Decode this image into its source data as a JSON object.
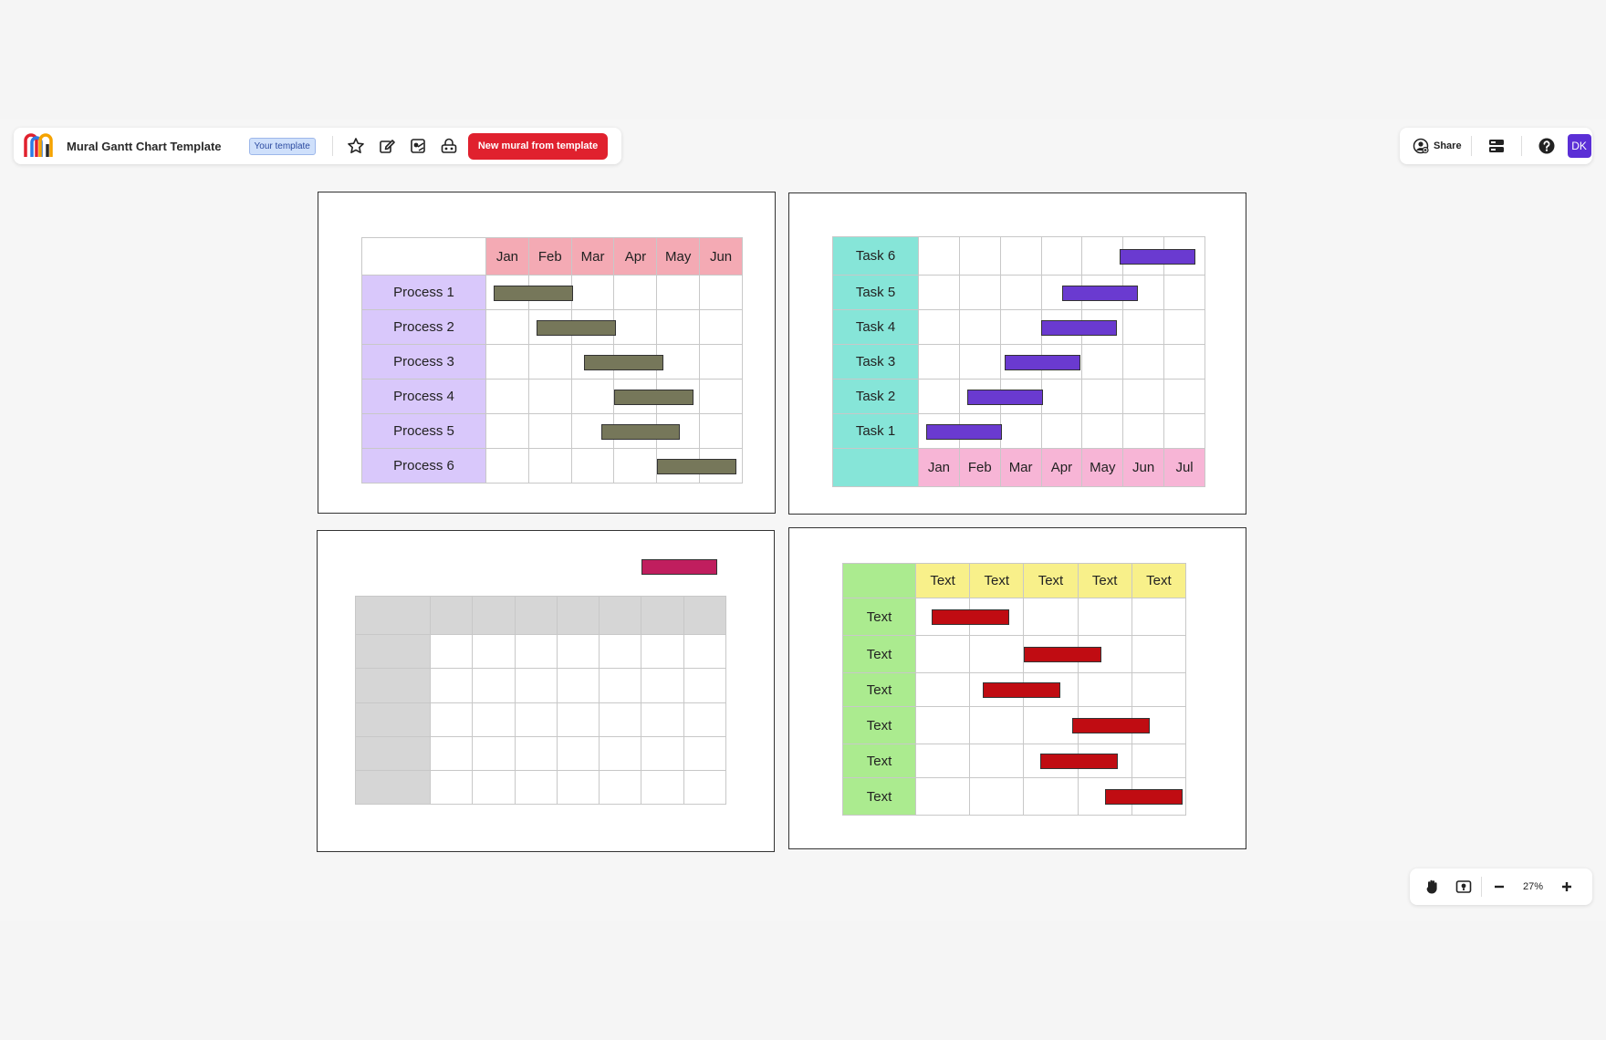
{
  "header": {
    "title": "Mural Gantt Chart Template",
    "badge": "Your template",
    "cta": "New mural from template"
  },
  "right": {
    "share": "Share",
    "avatar": "DK"
  },
  "zoom": {
    "level": "27%"
  },
  "colors": {
    "cta": "#e0212e",
    "avatar": "#5b2fd6",
    "olive_bar": "#76775a",
    "purple_bar": "#6a3ad0",
    "crimson_bar": "#c01e5e",
    "red_bar": "#c00c12"
  },
  "chart_data": [
    {
      "type": "table",
      "months": [
        "Jan",
        "Feb",
        "Mar",
        "Apr",
        "May",
        "Jun"
      ],
      "rows": [
        {
          "label": "Process 1",
          "start": 0.2,
          "end": 2.0
        },
        {
          "label": "Process 2",
          "start": 1.2,
          "end": 3.0
        },
        {
          "label": "Process 3",
          "start": 2.3,
          "end": 4.1
        },
        {
          "label": "Process 4",
          "start": 3.0,
          "end": 4.8
        },
        {
          "label": "Process 5",
          "start": 2.7,
          "end": 4.5
        },
        {
          "label": "Process 6",
          "start": 4.0,
          "end": 5.8
        }
      ]
    },
    {
      "type": "table",
      "months": [
        "Jan",
        "Feb",
        "Mar",
        "Apr",
        "May",
        "Jun",
        "Jul"
      ],
      "rows": [
        {
          "label": "Task 6",
          "start": 4.9,
          "end": 6.7
        },
        {
          "label": "Task 5",
          "start": 3.5,
          "end": 5.3
        },
        {
          "label": "Task 4",
          "start": 3.0,
          "end": 4.8
        },
        {
          "label": "Task 3",
          "start": 2.1,
          "end": 3.9
        },
        {
          "label": "Task 2",
          "start": 1.2,
          "end": 3.0
        },
        {
          "label": "Task 1",
          "start": 0.2,
          "end": 2.0
        }
      ]
    },
    {
      "type": "table",
      "months": [
        "",
        "",
        "",
        "",
        "",
        "",
        ""
      ],
      "rows": [
        {
          "label": ""
        },
        {
          "label": ""
        },
        {
          "label": ""
        },
        {
          "label": ""
        },
        {
          "label": ""
        }
      ]
    },
    {
      "type": "table",
      "months": [
        "Text",
        "Text",
        "Text",
        "Text",
        "Text"
      ],
      "rows": [
        {
          "label": "Text",
          "start": 0.3,
          "end": 1.7
        },
        {
          "label": "Text",
          "start": 2.0,
          "end": 3.4
        },
        {
          "label": "Text",
          "start": 1.25,
          "end": 2.65
        },
        {
          "label": "Text",
          "start": 2.9,
          "end": 4.3
        },
        {
          "label": "Text",
          "start": 2.3,
          "end": 3.7
        },
        {
          "label": "Text",
          "start": 3.5,
          "end": 4.9
        }
      ]
    }
  ]
}
